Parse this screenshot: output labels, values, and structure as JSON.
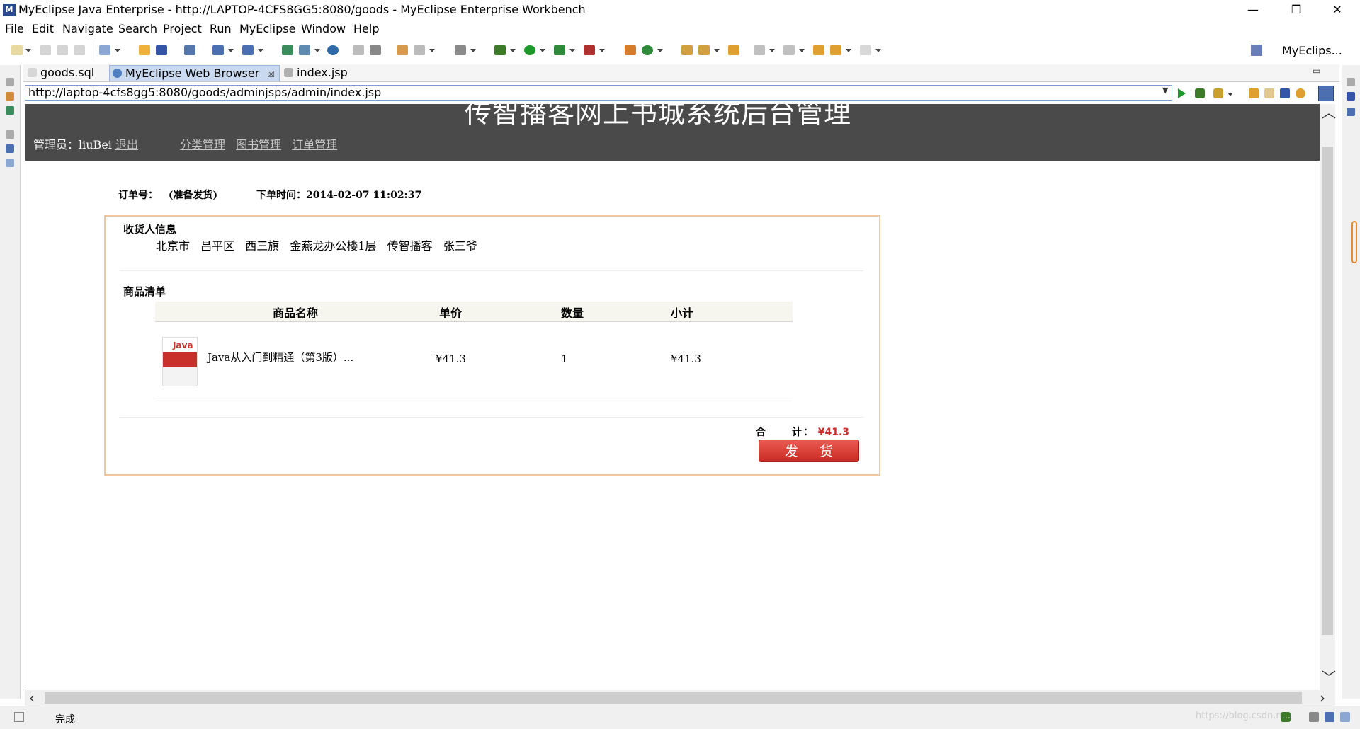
{
  "window": {
    "title": "MyEclipse Java Enterprise - http://LAPTOP-4CFS8GG5:8080/goods - MyEclipse Enterprise Workbench",
    "minimize": "—",
    "maximize": "❐",
    "close": "✕"
  },
  "menu": [
    "File",
    "Edit",
    "Navigate",
    "Search",
    "Project",
    "Run",
    "MyEclipse",
    "Window",
    "Help"
  ],
  "perspective": "MyEclips...",
  "tabs": [
    {
      "label": "goods.sql",
      "active": false
    },
    {
      "label": "MyEclipse Web Browser",
      "active": true,
      "close": "☒"
    },
    {
      "label": "index.jsp",
      "active": false
    }
  ],
  "address": {
    "url": "http://laptop-4cfs8gg5:8080/goods/adminjsps/admin/index.jsp"
  },
  "page": {
    "title": "传智播客网上书城系统后台管理",
    "admin_label": "管理员：",
    "admin_name": "liuBei",
    "logout": "退出",
    "nav": [
      "分类管理",
      "图书管理",
      "订单管理"
    ],
    "order_no_label": "订单号：",
    "order_status": "(准备发货)",
    "order_time_label": "下单时间：",
    "order_time": "2014-02-07 11:02:37",
    "receiver_title": "收货人信息",
    "receiver_address": [
      "北京市",
      "昌平区",
      "西三旗",
      "金燕龙办公楼1层",
      "传智播客",
      "张三爷"
    ],
    "items_title": "商品清单",
    "columns": [
      "商品名称",
      "单价",
      "数量",
      "小计"
    ],
    "items": [
      {
        "cover_text": "Java",
        "name": "Java从入门到精通（第3版）...",
        "price": "¥41.3",
        "quantity": "1",
        "subtotal": "¥41.3"
      }
    ],
    "total_label_1": "合",
    "total_label_2": "计：",
    "total_value": "¥41.3",
    "ship_button": "发货"
  },
  "status": {
    "text": "完成",
    "watermark": "https://blog.csdn.n..."
  },
  "colors": {
    "header_bg": "#4a4a4a",
    "accent_red": "#c9302c",
    "box_border": "#f2c79f",
    "active_tab": "#c9daf0"
  }
}
